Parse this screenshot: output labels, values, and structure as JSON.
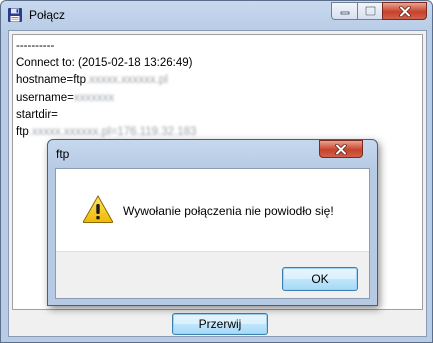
{
  "window": {
    "title": "Połącz",
    "icon": "floppy-disk-icon",
    "controls": [
      "minimize-icon",
      "maximize-icon",
      "close-icon"
    ]
  },
  "log": {
    "lines": [
      {
        "text": "----------",
        "blurred": ""
      },
      {
        "text": "Connect to: (2015-02-18 13:26:49)",
        "blurred": ""
      },
      {
        "text": "hostname=ftp",
        "blurred": ".xxxxx.xxxxxx.pl"
      },
      {
        "text": "username=",
        "blurred": "xxxxxxx"
      },
      {
        "text": "startdir=",
        "blurred": ""
      },
      {
        "text": "ftp",
        "blurred": ".xxxxx.xxxxxx.pl=176.119.32.183"
      }
    ]
  },
  "buttons": {
    "abort_label": "Przerwij"
  },
  "dialog": {
    "title": "ftp",
    "icon": "warning-icon",
    "message": "Wywołanie połączenia nie powiodło się!",
    "ok_label": "OK"
  },
  "colors": {
    "title_bar": "#b9cce6",
    "close_button": "#c7432a",
    "default_button": "#3c7fb1",
    "warning": "#f5c400"
  }
}
